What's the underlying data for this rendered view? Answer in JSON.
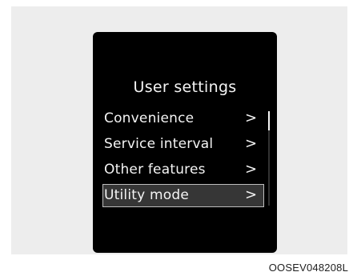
{
  "screen": {
    "title": "User settings",
    "items": [
      {
        "label": "Convenience",
        "arrow": ">"
      },
      {
        "label": "Service interval",
        "arrow": ">"
      },
      {
        "label": "Other features",
        "arrow": ">"
      },
      {
        "label": "Utility mode",
        "arrow": ">"
      }
    ],
    "selected_index": 3,
    "scroll_position": 0.0
  },
  "image_code": "OOSEV048208L",
  "colors": {
    "background": "#ededed",
    "screen": "#000000",
    "text": "#f4f4f4",
    "selection_border": "#bdbdbd"
  }
}
